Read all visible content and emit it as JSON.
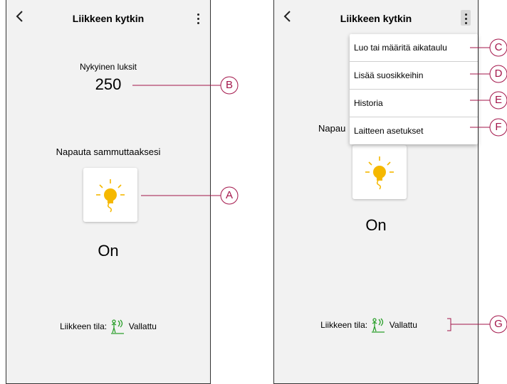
{
  "screen1": {
    "title": "Liikkeen kytkin",
    "lux_label": "Nykyinen luksit",
    "lux_value": "250",
    "tap_label": "Napauta sammuttaaksesi",
    "state": "On",
    "motion_label": "Liikkeen tila:",
    "motion_value": "Vallattu"
  },
  "screen2": {
    "title": "Liikkeen kytkin",
    "tap_label_partial": "Napau",
    "state": "On",
    "motion_label": "Liikkeen tila:",
    "motion_value": "Vallattu",
    "menu": [
      {
        "label": "Luo tai määritä aikataulu"
      },
      {
        "label": "Lisää suosikkeihin"
      },
      {
        "label": "Historia"
      },
      {
        "label": "Laitteen asetukset"
      }
    ]
  },
  "callouts": [
    "A",
    "B",
    "C",
    "D",
    "E",
    "F",
    "G"
  ],
  "colors": {
    "callout": "#a3154a",
    "bulb": "#f5b800",
    "motion_icon": "#2ca02c",
    "screen_bg": "#f2f2f2"
  },
  "icons": {
    "back": "chevron-left-icon",
    "more": "more-vertical-icon",
    "bulb": "lightbulb-icon",
    "motion": "motion-sensor-icon"
  }
}
